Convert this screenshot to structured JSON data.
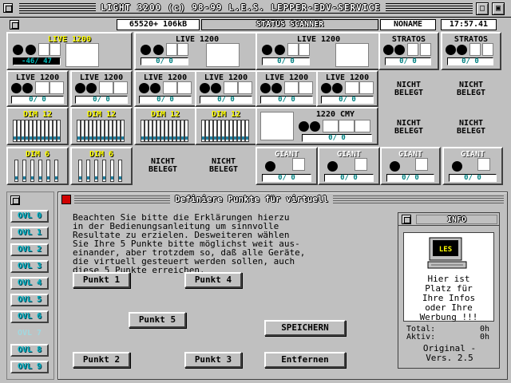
{
  "window": {
    "title": "LIGHT 3200 (c) 98-99 L.E.S. LEPPER-EDV-SERVICE"
  },
  "header": {
    "memory": "65520+ 106kB",
    "title": "STATUS SCANNER",
    "file": "NONAME",
    "time": "17:57.41"
  },
  "scanner": {
    "row1": [
      {
        "label": "LIVE 1200",
        "value": "-46/ 47"
      },
      {
        "label": "LIVE 1200",
        "value": "0/ 0"
      },
      {
        "label": "LIVE 1200",
        "value": "0/ 0"
      },
      {
        "label": "STRATOS",
        "value": "0/ 0"
      },
      {
        "label": "STRATOS",
        "value": "0/ 0"
      }
    ],
    "row2": [
      {
        "label": "LIVE 1200",
        "value": "0/ 0"
      },
      {
        "label": "LIVE 1200",
        "value": "0/ 0"
      },
      {
        "label": "LIVE 1200",
        "value": "0/ 0"
      },
      {
        "label": "LIVE 1200",
        "value": "0/ 0"
      },
      {
        "label": "LIVE 1200",
        "value": "0/ 0"
      },
      {
        "label": "LIVE 1200",
        "value": "0/ 0"
      }
    ],
    "row3": [
      {
        "label": "DIM 12"
      },
      {
        "label": "DIM 12"
      },
      {
        "label": "DIM 12"
      },
      {
        "label": "DIM 12"
      }
    ],
    "cmy": {
      "label": "1220 CMY",
      "value": "0/ 0"
    },
    "row4dim": [
      {
        "label": "DIM 6"
      },
      {
        "label": "DIM 6"
      }
    ],
    "giant": [
      {
        "label": "GIANT",
        "value": "0/ 0"
      },
      {
        "label": "GIANT",
        "value": "0/ 0"
      },
      {
        "label": "GIANT",
        "value": "0/ 0"
      },
      {
        "label": "GIANT",
        "value": "0/ 0"
      }
    ],
    "empty_line1": "NICHT",
    "empty_line2": "BELEGT"
  },
  "ovl": [
    "OVL 0",
    "OVL 1",
    "OVL 2",
    "OVL 3",
    "OVL 4",
    "OVL 5",
    "OVL 6",
    "OVL 7",
    "OVL 8",
    "OVL 9"
  ],
  "dialog": {
    "title": "Definiere Punkte für virtuell",
    "text": "Beachten Sie bitte die Erklärungen hierzu\nin der Bedienungsanleitung um sinnvolle\nResultate zu erzielen. Desweiteren wählen\nSie Ihre 5 Punkte bitte möglichst weit aus-\neinander, aber trotzdem so, daß alle Geräte,\ndie virtuell gesteuert werden sollen, auch\ndiese 5 Punkte erreichen.",
    "buttons": {
      "p1": "Punkt 1",
      "p4": "Punkt 4",
      "p5": "Punkt 5",
      "p2": "Punkt 2",
      "p3": "Punkt 3",
      "save": "SPEICHERN",
      "remove": "Entfernen"
    }
  },
  "info": {
    "title": "INFO",
    "logo": "LES",
    "text": "Hier ist\nPlatz für\nIhre Infos\noder Ihre\nWerbung !!!",
    "total_label": "Total:",
    "total_value": "0h",
    "active_label": "Aktiv:",
    "active_value": "0h",
    "edition": "Original -",
    "version": "Vers. 2.5"
  },
  "colors": {
    "background": "#c0c0c0",
    "yellow_label": "#ffff00",
    "cyan_text": "#00b0c0",
    "close_red": "#d00000"
  }
}
